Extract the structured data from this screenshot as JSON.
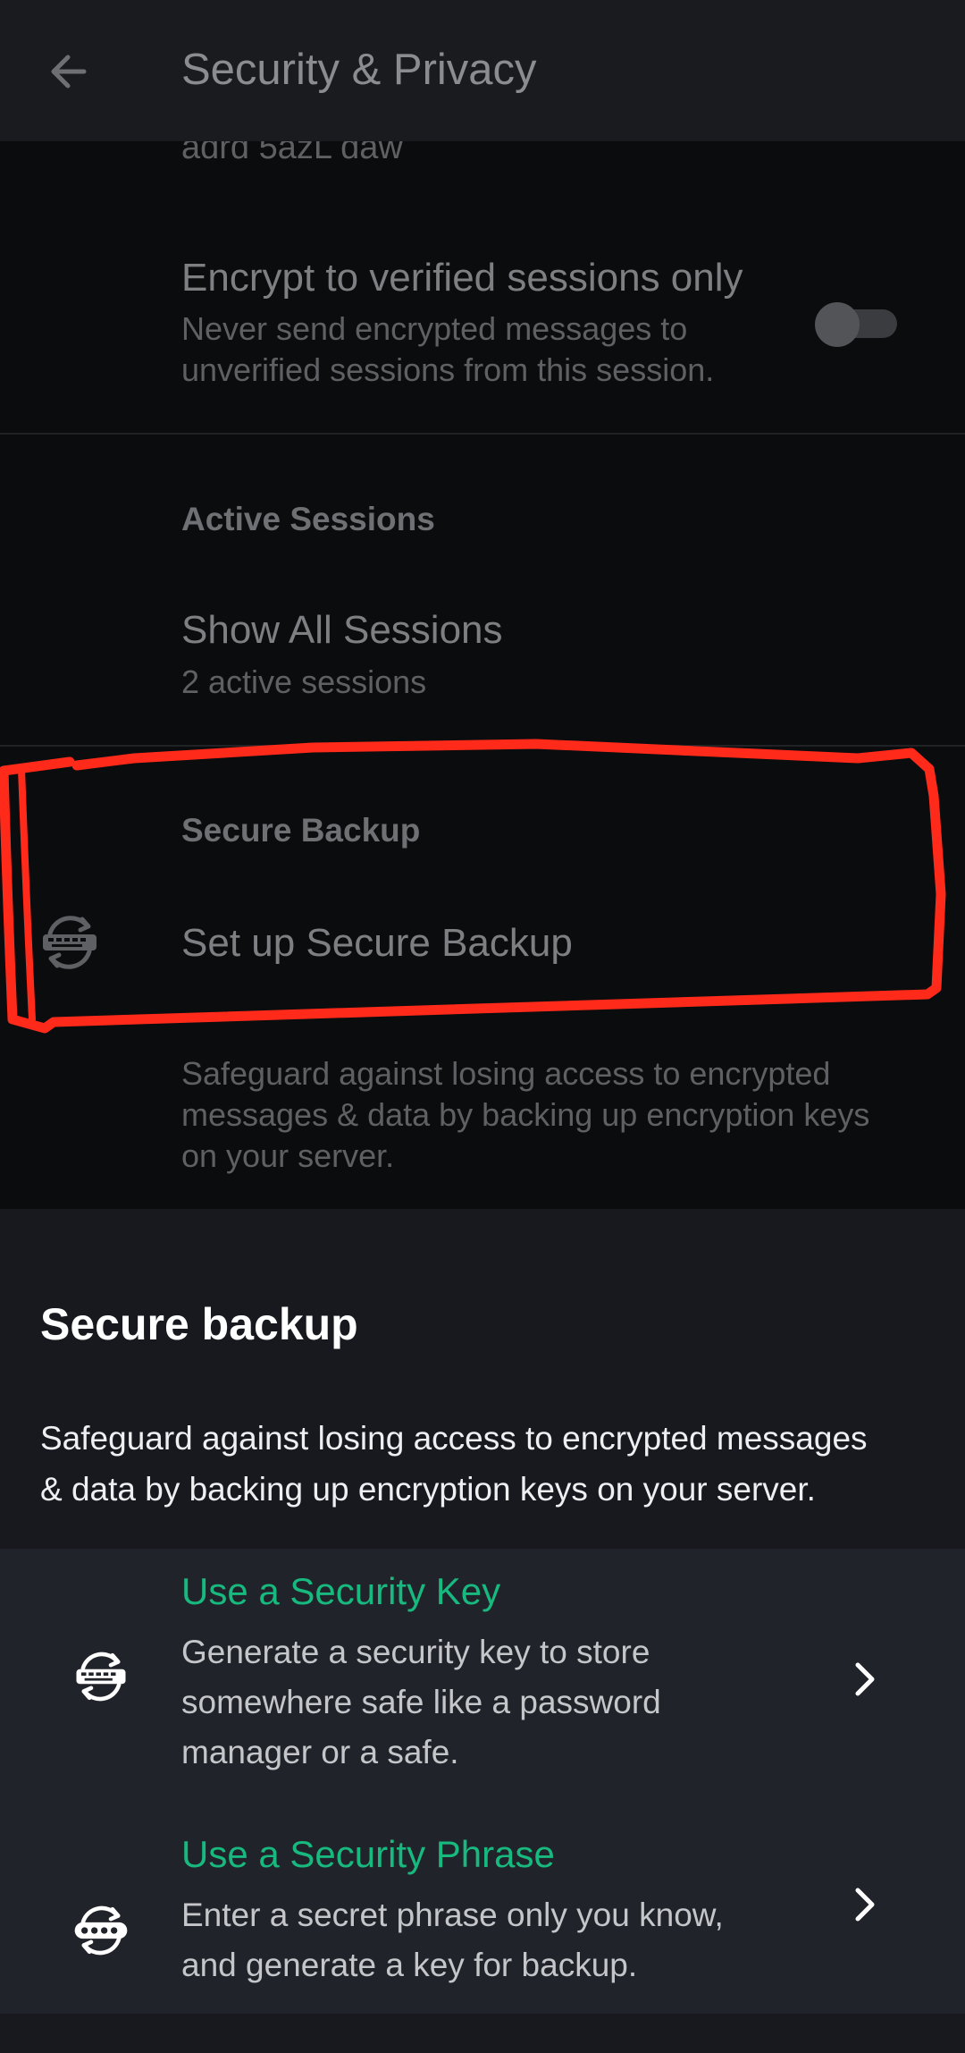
{
  "appbar": {
    "title": "Security & Privacy",
    "back_icon": "arrow-left-icon"
  },
  "partial_text": "adrd 5azL daw",
  "encrypt_row": {
    "title": "Encrypt to verified sessions only",
    "description_line1": "Never send encrypted messages to",
    "description_line2": "unverified sessions from this session.",
    "toggle_on": false
  },
  "active_sessions": {
    "section_title": "Active Sessions",
    "row_title": "Show All Sessions",
    "row_subtitle": "2 active sessions"
  },
  "secure_backup_section": {
    "section_title": "Secure Backup",
    "row_title": "Set up Secure Backup",
    "row_icon": "key-backup-icon",
    "footer_line1": "Safeguard against losing access to encrypted",
    "footer_line2": "messages & data by backing up encryption keys",
    "footer_line3": "on your server."
  },
  "sheet": {
    "title": "Secure backup",
    "description_line1": "Safeguard against losing access to encrypted messages",
    "description_line2": "& data by backing up encryption keys on your server.",
    "options": [
      {
        "title": "Use a Security Key",
        "line1": "Generate a security key to store",
        "line2": "somewhere safe like a password",
        "line3": "manager or a safe.",
        "icon": "key-backup-icon"
      },
      {
        "title": "Use a Security Phrase",
        "line1": "Enter a secret phrase only you know,",
        "line2": "and generate a key for backup.",
        "icon": "phrase-backup-icon"
      }
    ]
  },
  "colors": {
    "accent": "#18b97f",
    "annotation": "#ff2a1a",
    "sheet_background": "#17191e",
    "options_background": "#202329"
  }
}
